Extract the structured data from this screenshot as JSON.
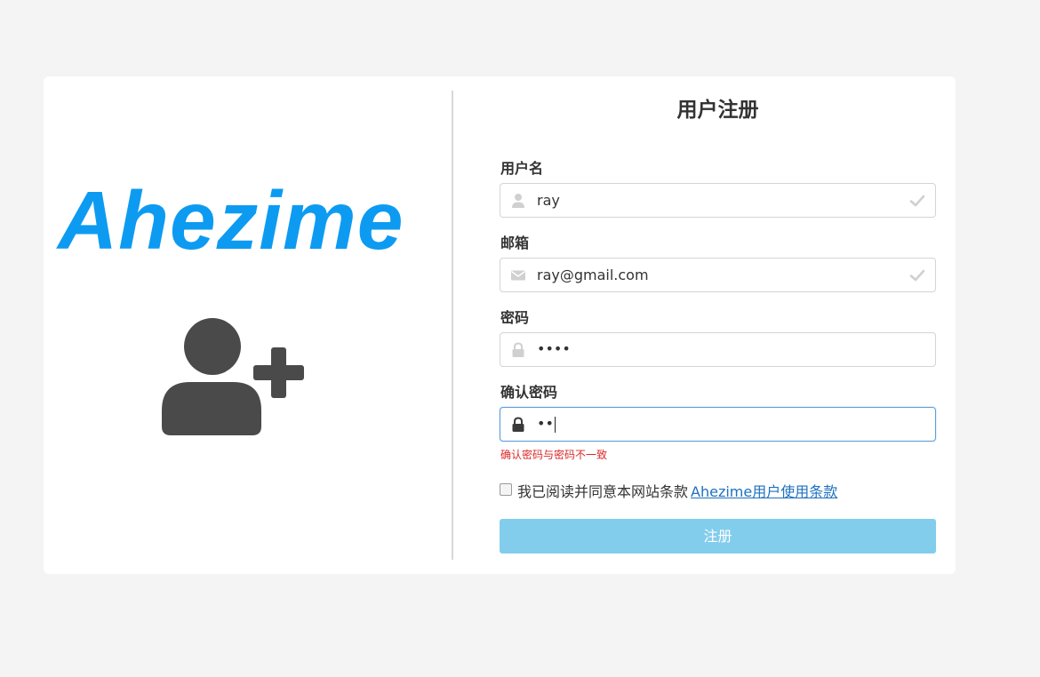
{
  "brand": {
    "name": "Ahezime",
    "color": "#0d9bf2"
  },
  "form": {
    "title": "用户注册",
    "fields": [
      {
        "label": "用户名",
        "value": "ray",
        "icon": "user-icon",
        "valid": true
      },
      {
        "label": "邮箱",
        "value": "ray@gmail.com",
        "icon": "envelope-icon",
        "valid": true
      },
      {
        "label": "密码",
        "value": "••••",
        "icon": "lock-icon",
        "valid": false
      },
      {
        "label": "确认密码",
        "value": "••",
        "icon": "lock-icon",
        "valid": false,
        "focused": true
      }
    ],
    "error": "确认密码与密码不一致",
    "agree": {
      "text": "我已阅读并同意本网站条款",
      "link": "Ahezime用户使用条款",
      "checked": false
    },
    "submit_label": "注册"
  },
  "colors": {
    "accent": "#0d9bf2",
    "button": "#83cdec",
    "error": "#db2828",
    "link": "#1e70bf",
    "background": "#f4f4f4"
  }
}
